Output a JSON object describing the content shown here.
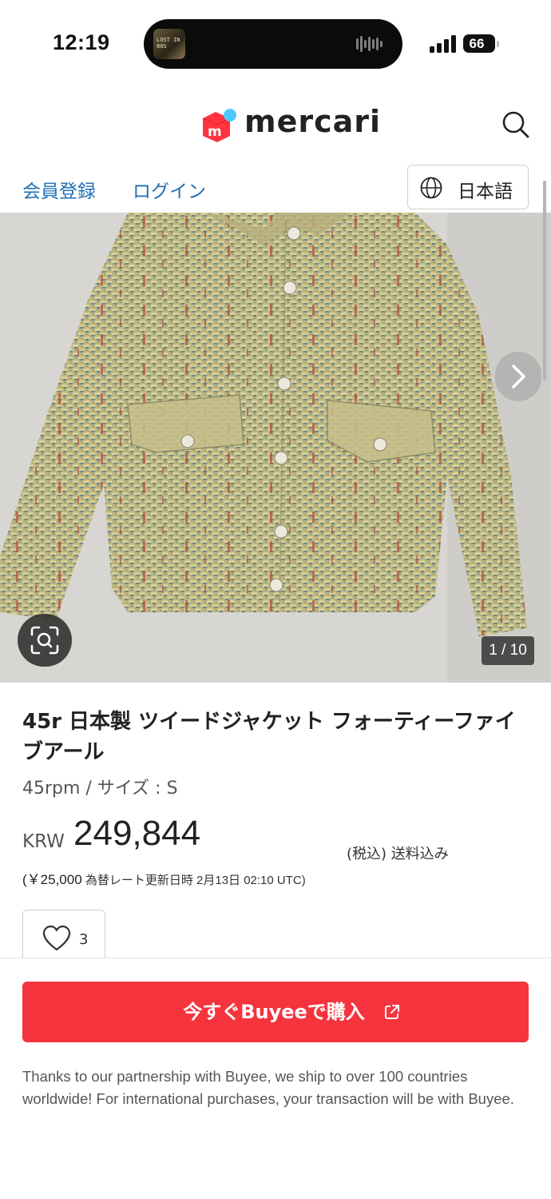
{
  "status_bar": {
    "time": "12:19",
    "now_playing_art_text": "LOST IN 80S",
    "battery": "66"
  },
  "header": {
    "logo_text": "mercari",
    "register_link": "会員登録",
    "login_link": "ログイン",
    "language": "日本語"
  },
  "gallery": {
    "counter": "1 / 10"
  },
  "product": {
    "title": "45r 日本製 ツイードジャケット フォーティーファイブアール",
    "brand_size": "45rpm / サイズ : S",
    "currency": "KRW",
    "price": "249,844",
    "tax_shipping": "(税込) 送料込み",
    "jpy_price": "(￥25,000",
    "rate_note": " 為替レート更新日時 2月13日 02:10 UTC)",
    "likes": "3"
  },
  "purchase": {
    "buy_label": "今すぐBuyeeで購入",
    "partner_note": "Thanks to our partnership with Buyee, we ship to over 100 countries worldwide! For international purchases, your transaction will be with Buyee."
  },
  "colors": {
    "brand_red": "#f5343e",
    "link_blue": "#1f6fb5",
    "logo_red": "#ff333f",
    "logo_blue": "#4dc9ff"
  }
}
